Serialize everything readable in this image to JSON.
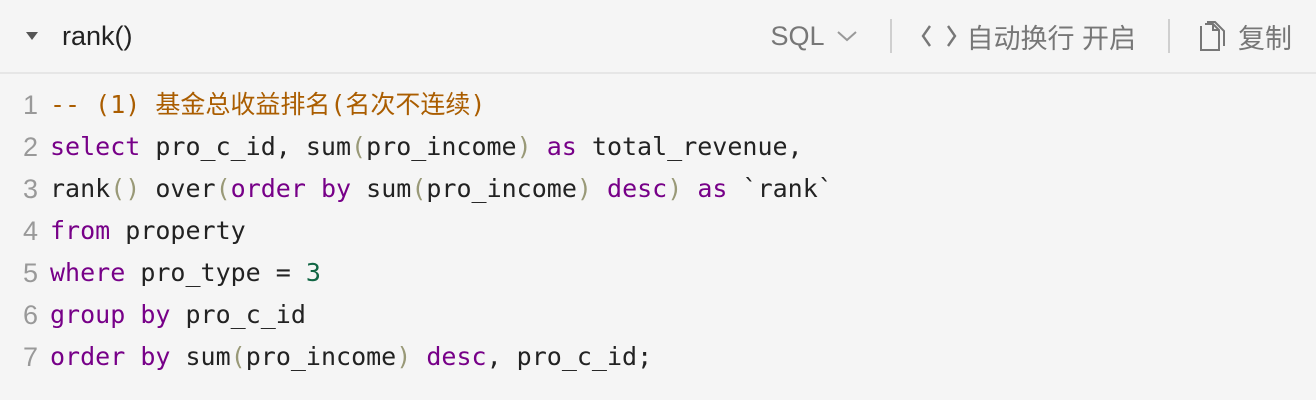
{
  "header": {
    "title": "rank()",
    "language": "SQL",
    "wrap_label": "自动换行 开启",
    "copy_label": "复制"
  },
  "code": {
    "lines": [
      {
        "number": "1",
        "tokens": [
          {
            "type": "comment",
            "text": "-- (1) 基金总收益排名(名次不连续)"
          }
        ]
      },
      {
        "number": "2",
        "tokens": [
          {
            "type": "kw",
            "text": "select"
          },
          {
            "type": "plain",
            "text": " pro_c_id, sum"
          },
          {
            "type": "paren",
            "text": "("
          },
          {
            "type": "plain",
            "text": "pro_income"
          },
          {
            "type": "paren",
            "text": ")"
          },
          {
            "type": "plain",
            "text": " "
          },
          {
            "type": "kw",
            "text": "as"
          },
          {
            "type": "plain",
            "text": " total_revenue,"
          }
        ]
      },
      {
        "number": "3",
        "tokens": [
          {
            "type": "plain",
            "text": "rank"
          },
          {
            "type": "paren",
            "text": "()"
          },
          {
            "type": "plain",
            "text": " over"
          },
          {
            "type": "paren",
            "text": "("
          },
          {
            "type": "kw",
            "text": "order"
          },
          {
            "type": "plain",
            "text": " "
          },
          {
            "type": "kw",
            "text": "by"
          },
          {
            "type": "plain",
            "text": " sum"
          },
          {
            "type": "paren",
            "text": "("
          },
          {
            "type": "plain",
            "text": "pro_income"
          },
          {
            "type": "paren",
            "text": ")"
          },
          {
            "type": "plain",
            "text": " "
          },
          {
            "type": "kw",
            "text": "desc"
          },
          {
            "type": "paren",
            "text": ")"
          },
          {
            "type": "plain",
            "text": " "
          },
          {
            "type": "kw",
            "text": "as"
          },
          {
            "type": "plain",
            "text": " `rank`"
          }
        ]
      },
      {
        "number": "4",
        "tokens": [
          {
            "type": "kw",
            "text": "from"
          },
          {
            "type": "plain",
            "text": " property"
          }
        ]
      },
      {
        "number": "5",
        "tokens": [
          {
            "type": "kw",
            "text": "where"
          },
          {
            "type": "plain",
            "text": " pro_type = "
          },
          {
            "type": "num",
            "text": "3"
          }
        ]
      },
      {
        "number": "6",
        "tokens": [
          {
            "type": "kw",
            "text": "group"
          },
          {
            "type": "plain",
            "text": " "
          },
          {
            "type": "kw",
            "text": "by"
          },
          {
            "type": "plain",
            "text": " pro_c_id"
          }
        ]
      },
      {
        "number": "7",
        "tokens": [
          {
            "type": "kw",
            "text": "order"
          },
          {
            "type": "plain",
            "text": " "
          },
          {
            "type": "kw",
            "text": "by"
          },
          {
            "type": "plain",
            "text": " sum"
          },
          {
            "type": "paren",
            "text": "("
          },
          {
            "type": "plain",
            "text": "pro_income"
          },
          {
            "type": "paren",
            "text": ")"
          },
          {
            "type": "plain",
            "text": " "
          },
          {
            "type": "kw",
            "text": "desc"
          },
          {
            "type": "plain",
            "text": ", pro_c_id;"
          }
        ]
      }
    ]
  },
  "icons": {
    "collapse": "caret-down-icon",
    "language_dropdown": "chevron-down-icon",
    "wrap": "code-brackets-icon",
    "copy": "copy-icon"
  },
  "colors": {
    "keyword": "#770088",
    "comment": "#aa5d00",
    "number": "#116644",
    "paren": "#999977",
    "text": "#222222",
    "line_number": "#999999",
    "background": "#f5f5f5"
  }
}
